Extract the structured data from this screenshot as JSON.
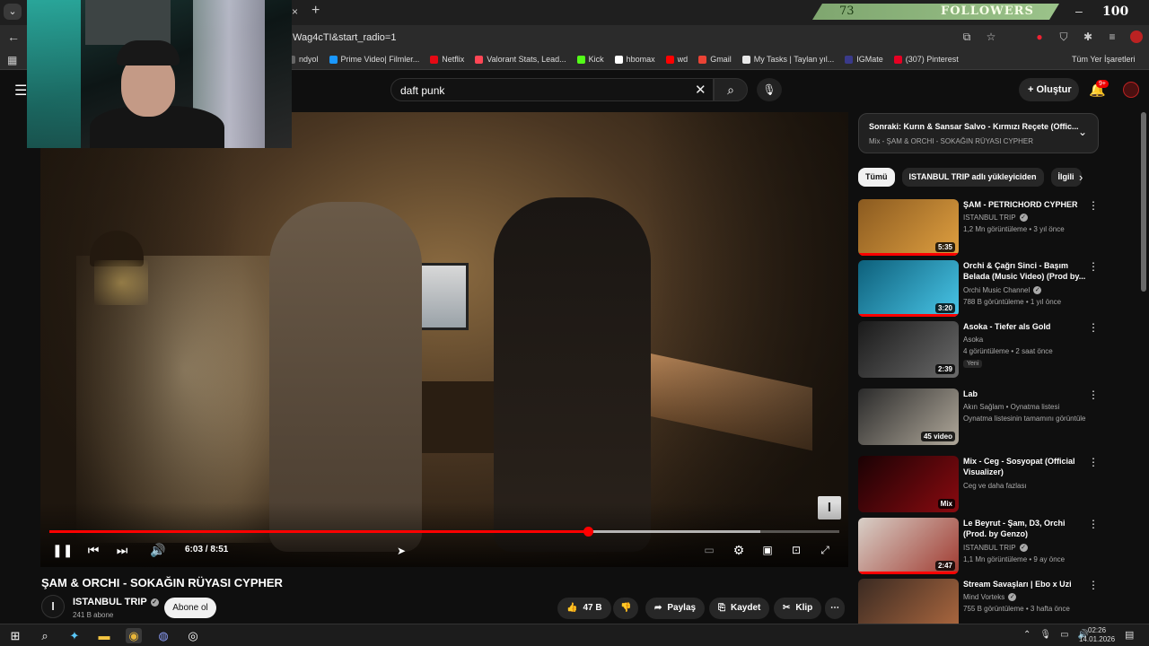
{
  "browser": {
    "tab_close": "×",
    "tab_new": "+",
    "url_fragment": "Wag4cTI&start_radio=1",
    "bookmarks": [
      {
        "label": "ndyol",
        "color": "#666666"
      },
      {
        "label": "Prime Video| Filmler...",
        "color": "#1a98ff"
      },
      {
        "label": "Netflix",
        "color": "#e50914"
      },
      {
        "label": "Valorant Stats, Lead...",
        "color": "#ff4655"
      },
      {
        "label": "Kick",
        "color": "#53fc18"
      },
      {
        "label": "hbomax",
        "color": "#ffffff"
      },
      {
        "label": "wd",
        "color": "#ff0000"
      },
      {
        "label": "Gmail",
        "color": "#ea4335"
      },
      {
        "label": "My Tasks | Taylan yıl...",
        "color": "#e8e8e8"
      },
      {
        "label": "IGMate",
        "color": "#3a3a8a"
      },
      {
        "label": "(307) Pinterest",
        "color": "#e60023"
      }
    ],
    "all_bookmarks": "Tüm Yer İşaretleri"
  },
  "overlay": {
    "follower_count": "73",
    "follower_label": "FOLLOWERS",
    "counter_right": "100"
  },
  "header": {
    "search_value": "daft punk",
    "create_label": "Oluştur",
    "notif_badge": "9+"
  },
  "player": {
    "time_display": "6:03 / 8:51",
    "progress_fraction": 0.682,
    "buffer_fraction": 0.9,
    "watermark": "I"
  },
  "video": {
    "title": "ŞAM & ORCHI - SOKAĞIN RÜYASI CYPHER",
    "channel_name": "ISTANBUL TRIP",
    "subscribers": "241 B abone",
    "subscribe_label": "Abone ol",
    "likes": "47 B",
    "share_label": "Paylaş",
    "save_label": "Kaydet",
    "clip_label": "Klip"
  },
  "up_next": {
    "title": "Sonraki: Kurın & Sansar Salvo - Kırmızı Reçete (Offic...",
    "subtitle": "Mix - ŞAM & ORCHI - SOKAĞIN RÜYASI CYPHER"
  },
  "chips": [
    "Tümü",
    "ISTANBUL TRIP adlı yükleyiciden",
    "İlgili"
  ],
  "recommendations": [
    {
      "title": "ŞAM - PETRICHORD CYPHER",
      "channel": "ISTANBUL TRIP",
      "verified": true,
      "meta": "1,2 Mn görüntüleme • 3 yıl önce",
      "duration": "5:35",
      "color1": "#8a5a20",
      "color2": "#e0a040",
      "progress": 1.0
    },
    {
      "title": "Orchi & Çağrı Sinci - Başım Belada (Music Video) (Prod by...",
      "channel": "Orchi Music Channel",
      "verified": true,
      "meta": "788 B görüntüleme • 1 yıl önce",
      "duration": "3:20",
      "color1": "#0d5f7a",
      "color2": "#49c6e8",
      "progress": 1.0
    },
    {
      "title": "Asoka - Tiefer als Gold",
      "channel": "Asoka",
      "verified": false,
      "meta": "4 görüntüleme • 2 saat önce",
      "badge": "Yeni",
      "duration": "2:39",
      "color1": "#1a1a1a",
      "color2": "#6a6a6a",
      "progress": 0
    },
    {
      "title": "Lab",
      "channel": "Akın Sağlam • Oynatma listesi",
      "verified": false,
      "meta": "Oynatma listesinin tamamını görüntüle",
      "duration": "45 video",
      "color1": "#2a2a2a",
      "color2": "#b0a89a",
      "progress": 0
    },
    {
      "title": "Mix - Ceg - Sosyopat (Official Visualizer)",
      "channel": "Ceg ve daha fazlası",
      "verified": false,
      "meta": "",
      "duration": "Mix",
      "color1": "#1a0204",
      "color2": "#8a0a10",
      "progress": 0
    },
    {
      "title": "Le Beyrut - Şam, D3, Orchi (Prod. by Genzo)",
      "channel": "ISTANBUL TRIP",
      "verified": true,
      "meta": "1,1 Mn görüntüleme • 9 ay önce",
      "duration": "2:47",
      "color1": "#d8d0c8",
      "color2": "#a03a30",
      "progress": 1.0
    },
    {
      "title": "Stream Savaşları | Ebo x Uzi",
      "channel": "Mind Vorteks",
      "verified": true,
      "meta": "755 B görüntüleme • 3 hafta önce",
      "duration": "",
      "color1": "#3a2a22",
      "color2": "#b06a40",
      "progress": 0
    }
  ],
  "taskbar": {
    "time": "02:26",
    "date": "14.01.2026"
  }
}
